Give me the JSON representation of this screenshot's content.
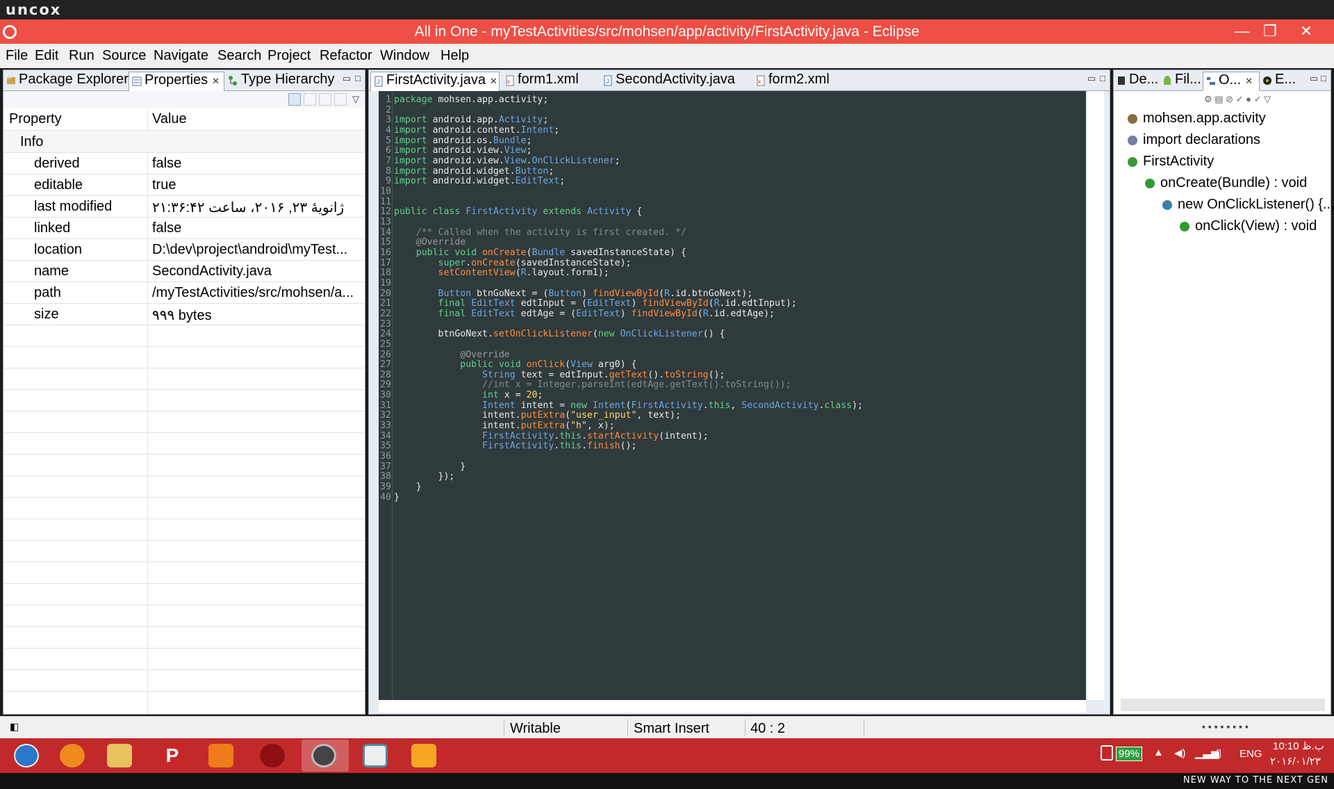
{
  "brand": "uncox",
  "window": {
    "title": "All in One - myTestActivities/src/mohsen/app/activity/FirstActivity.java - Eclipse",
    "minimize": "—",
    "maximize": "❐",
    "close": "✕"
  },
  "menu": [
    "File",
    "Edit",
    "Run",
    "Source",
    "Navigate",
    "Search",
    "Project",
    "Refactor",
    "Window",
    "Help"
  ],
  "left_panel": {
    "tabs": [
      "Package Explorer",
      "Properties",
      "Type Hierarchy"
    ],
    "active_tab": "Properties",
    "columns": [
      "Property",
      "Value"
    ],
    "group": "Info",
    "rows": [
      {
        "property": "derived",
        "value": "false"
      },
      {
        "property": "editable",
        "value": "true"
      },
      {
        "property": "last modified",
        "value": "ژانویهٔ ۲۳, ۲۰۱۶، ساعت ۲۱:۳۶:۴۲"
      },
      {
        "property": "linked",
        "value": "false"
      },
      {
        "property": "location",
        "value": "D:\\dev\\project\\android\\myTest..."
      },
      {
        "property": "name",
        "value": "SecondActivity.java"
      },
      {
        "property": "path",
        "value": "/myTestActivities/src/mohsen/a..."
      },
      {
        "property": "size",
        "value": "۹۹۹  bytes"
      }
    ]
  },
  "editor": {
    "tabs": [
      "FirstActivity.java",
      "form1.xml",
      "SecondActivity.java",
      "form2.xml"
    ],
    "active_tab": "FirstActivity.java",
    "lines": [
      "package mohsen.app.activity;",
      "",
      "import android.app.Activity;",
      "import android.content.Intent;",
      "import android.os.Bundle;",
      "import android.view.View;",
      "import android.view.View.OnClickListener;",
      "import android.widget.Button;",
      "import android.widget.EditText;",
      "",
      "",
      "public class FirstActivity extends Activity {",
      "",
      "    /** Called when the activity is first created. */",
      "    @Override",
      "    public void onCreate(Bundle savedInstanceState) {",
      "        super.onCreate(savedInstanceState);",
      "        setContentView(R.layout.form1);",
      "",
      "        Button btnGoNext = (Button) findViewById(R.id.btnGoNext);",
      "        final EditText edtInput = (EditText) findViewById(R.id.edtInput);",
      "        final EditText edtAge = (EditText) findViewById(R.id.edtAge);",
      "",
      "        btnGoNext.setOnClickListener(new OnClickListener() {",
      "",
      "            @Override",
      "            public void onClick(View arg0) {",
      "                String text = edtInput.getText().toString();",
      "                //int x = Integer.parseInt(edtAge.getText().toString());",
      "                int x = 20;",
      "                Intent intent = new Intent(FirstActivity.this, SecondActivity.class);",
      "                intent.putExtra(\"user_input\", text);",
      "                intent.putExtra(\"h\", x);",
      "                FirstActivity.this.startActivity(intent);",
      "                FirstActivity.this.finish();",
      "",
      "            }",
      "        });",
      "    }",
      "}"
    ]
  },
  "right_panel": {
    "tabs": [
      "De...",
      "Fil...",
      "O...",
      "E..."
    ],
    "outline": [
      {
        "label": "mohsen.app.activity",
        "level": 0,
        "color": "#8a6d3b"
      },
      {
        "label": "import declarations",
        "level": 0,
        "color": "#6f7fa8"
      },
      {
        "label": "FirstActivity",
        "level": 0,
        "color": "#3a9a3a"
      },
      {
        "label": "onCreate(Bundle) : void",
        "level": 1,
        "color": "#2e9b2e"
      },
      {
        "label": "new OnClickListener() {...",
        "level": 2,
        "color": "#3a7fa8"
      },
      {
        "label": "onClick(View) : void",
        "level": 3,
        "color": "#2e9b2e"
      }
    ]
  },
  "status": {
    "mode": "Writable",
    "insert": "Smart Insert",
    "position": "40 : 2"
  },
  "taskbar": {
    "battery": "99%",
    "lang": "ENG",
    "time": "10:10 ب.ظ",
    "date": "۲۰۱۶/۰۱/۲۳",
    "footer": "NEW WAY TO THE NEXT GEN"
  }
}
